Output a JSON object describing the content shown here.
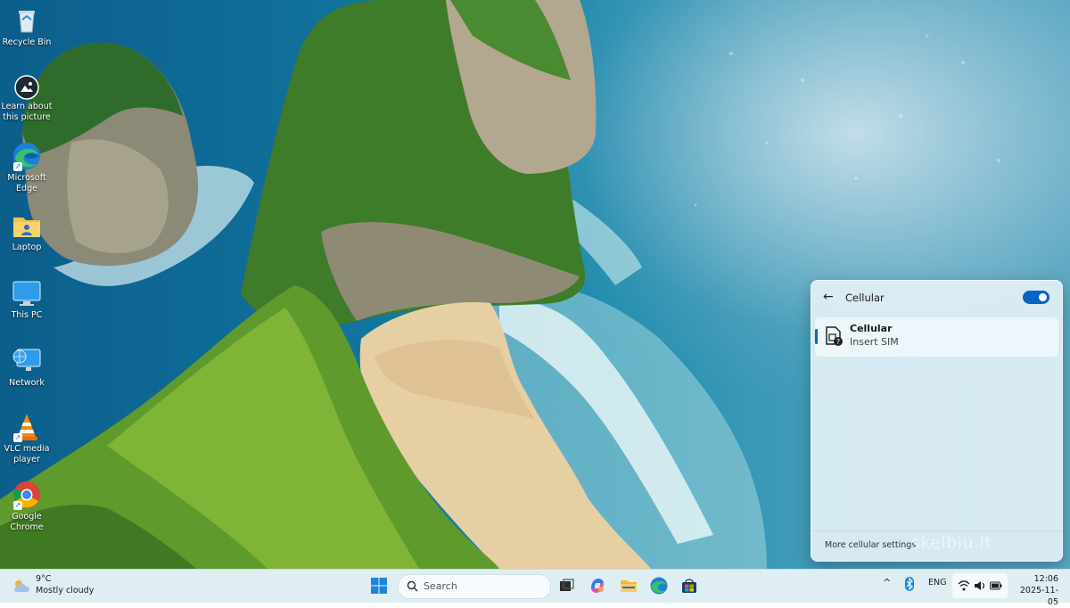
{
  "desktop": {
    "icons": [
      {
        "label": "Recycle Bin",
        "icon": "recycle-bin-icon",
        "shortcut": false
      },
      {
        "label": "Learn about this picture",
        "icon": "camera-info-icon",
        "shortcut": false
      },
      {
        "label": "Microsoft Edge",
        "icon": "edge-icon",
        "shortcut": true
      },
      {
        "label": "Laptop",
        "icon": "user-folder-icon",
        "shortcut": false
      },
      {
        "label": "This PC",
        "icon": "monitor-icon",
        "shortcut": false
      },
      {
        "label": "Network",
        "icon": "network-icon",
        "shortcut": false
      },
      {
        "label": "VLC media player",
        "icon": "vlc-cone-icon",
        "shortcut": true
      },
      {
        "label": "Google Chrome",
        "icon": "chrome-icon",
        "shortcut": true
      }
    ]
  },
  "flyout": {
    "title": "Cellular",
    "toggle_on": true,
    "item": {
      "name": "Cellular",
      "status": "Insert SIM"
    },
    "footer_link": "More cellular settings"
  },
  "watermark": "skelbiu.lt",
  "taskbar": {
    "weather": {
      "temp": "9°C",
      "condition": "Mostly cloudy"
    },
    "search_placeholder": "Search",
    "apps": [
      "windows-start-icon",
      "task-view-icon",
      "copilot-icon",
      "file-explorer-icon",
      "edge-icon",
      "store-icon"
    ],
    "tray": {
      "language": "ENG"
    },
    "clock": {
      "time": "12:06",
      "date": "2025-11-05"
    }
  },
  "colors": {
    "accent": "#0a63c4",
    "taskbar": "#dfeef3",
    "flyout": "#e2f0f6"
  }
}
